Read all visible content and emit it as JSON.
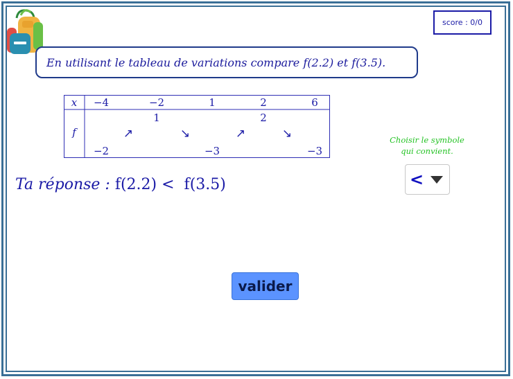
{
  "score": {
    "label": "score : 0/0"
  },
  "question": {
    "text": "En utilisant le tableau de variations compare f(2.2) et f(3.5)."
  },
  "variation_table": {
    "header_x": "x",
    "header_f": "f",
    "x_values": [
      "−4",
      "−2",
      "1",
      "2",
      "6"
    ],
    "f_top": [
      "1",
      "2"
    ],
    "f_bottom": [
      "−2",
      "−3",
      "−3"
    ],
    "arrows": [
      "↗",
      "↘",
      "↗",
      "↘"
    ]
  },
  "hint": {
    "line1": "Choisir le symbole",
    "line2": "qui convient."
  },
  "symbol_select": {
    "selected": "<"
  },
  "answer": {
    "label": "Ta réponse : ",
    "left": "f(2.2) ",
    "right": "  f(3.5)"
  },
  "valider_button": {
    "label": "valider"
  },
  "colors": {
    "frame": "#3a6f96",
    "text_blue": "#1a1aa6",
    "hint_green": "#23c223",
    "button": "#5b93ff"
  }
}
